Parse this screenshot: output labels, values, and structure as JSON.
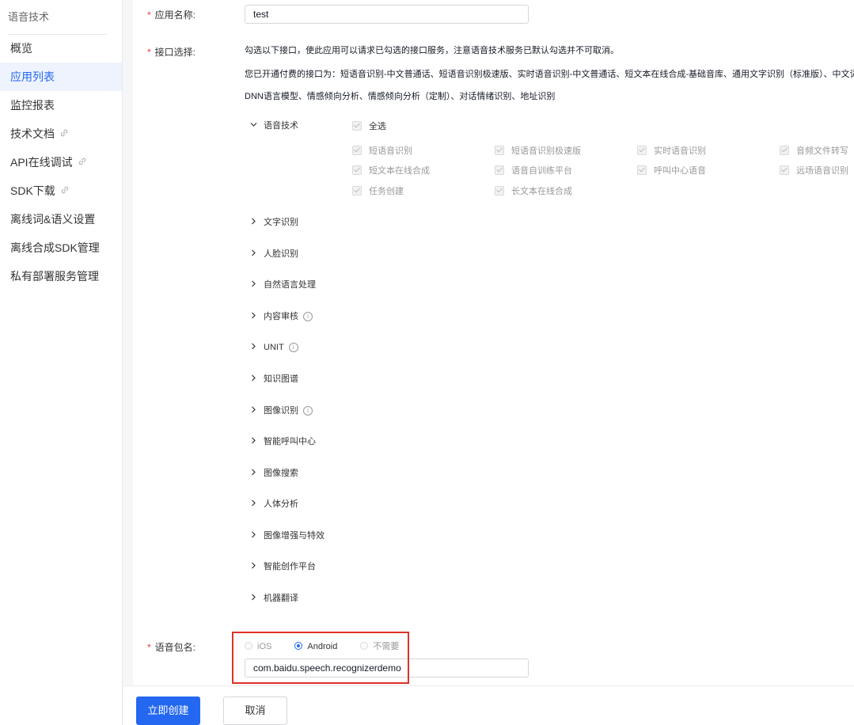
{
  "sidebar": {
    "title": "语音技术",
    "items": [
      {
        "label": "概览"
      },
      {
        "label": "应用列表"
      },
      {
        "label": "监控报表"
      },
      {
        "label": "技术文档"
      },
      {
        "label": "API在线调试"
      },
      {
        "label": "SDK下载"
      },
      {
        "label": "离线词&语义设置"
      },
      {
        "label": "离线合成SDK管理"
      },
      {
        "label": "私有部署服务管理"
      }
    ]
  },
  "form": {
    "app_name": {
      "label": "应用名称:",
      "value": "test"
    },
    "api": {
      "label": "接口选择:",
      "desc1": "勾选以下接口，使此应用可以请求已勾选的接口服务，注意语音技术服务已默认勾选并不可取消。",
      "desc2": "您已开通付费的接口为：短语音识别-中文普通话、短语音识别极速版、实时语音识别-中文普通话、短文本在线合成-基础音库、通用文字识别（标准版）、中文词向",
      "desc3": "DNN语言模型、情感倾向分析、情感倾向分析（定制）、对话情绪识别、地址识别"
    },
    "speech_category": {
      "label": "语音技术",
      "select_all": "全选",
      "options": [
        "短语音识别",
        "短语音识别极速版",
        "实时语音识别",
        "音频文件转写",
        "短文本在线合成",
        "语音自训练平台",
        "呼叫中心语音",
        "远场语音识别",
        "任务创建",
        "长文本在线合成"
      ]
    },
    "categories": [
      {
        "label": "文字识别"
      },
      {
        "label": "人脸识别"
      },
      {
        "label": "自然语言处理"
      },
      {
        "label": "内容审核"
      },
      {
        "label": "UNIT"
      },
      {
        "label": "知识图谱"
      },
      {
        "label": "图像识别"
      },
      {
        "label": "智能呼叫中心"
      },
      {
        "label": "图像搜索"
      },
      {
        "label": "人体分析"
      },
      {
        "label": "图像增强与特效"
      },
      {
        "label": "智能创作平台"
      },
      {
        "label": "机器翻译"
      }
    ],
    "package": {
      "label": "语音包名:",
      "options": [
        {
          "label": "iOS",
          "checked": false
        },
        {
          "label": "Android",
          "checked": true
        },
        {
          "label": "不需要",
          "checked": false
        }
      ],
      "value": "com.baidu.speech.recognizerdemo"
    }
  },
  "footer": {
    "create_label": "立即创建",
    "cancel_label": "取消"
  },
  "colors": {
    "primary": "#2468f2",
    "required": "#ff3333",
    "highlight": "#e0302a"
  }
}
